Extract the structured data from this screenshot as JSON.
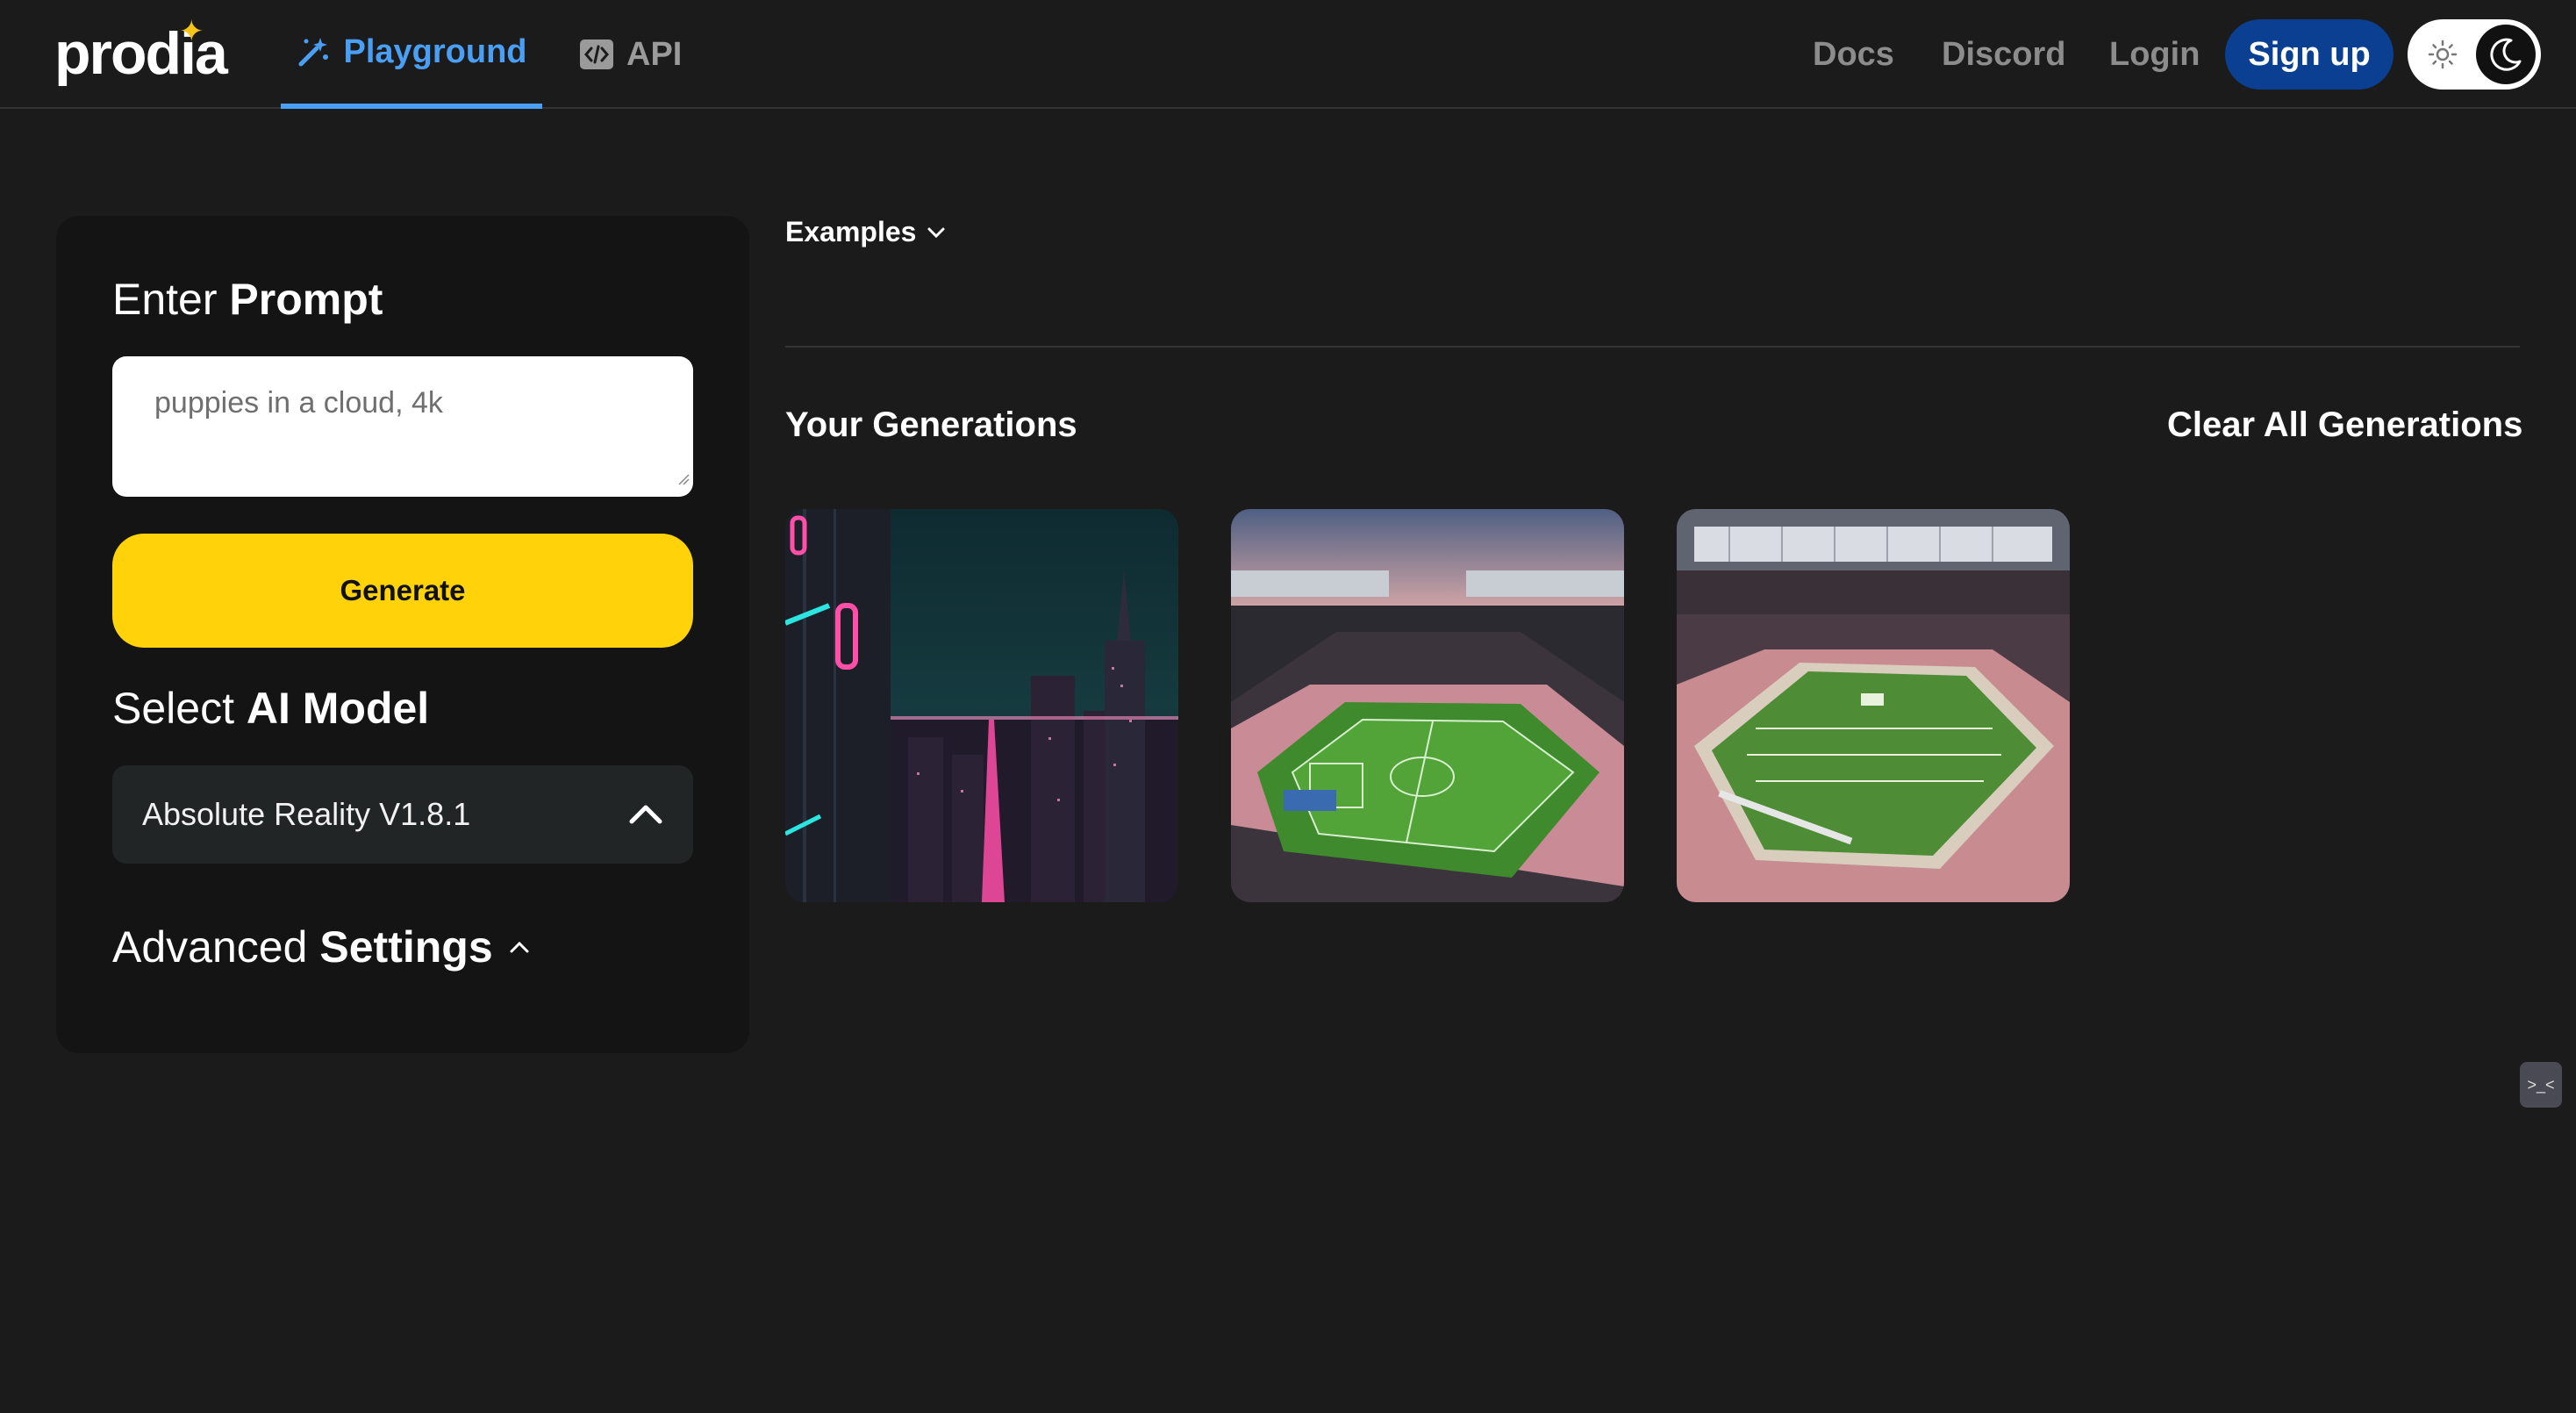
{
  "header": {
    "logo_text": "prodia",
    "tabs": [
      {
        "label": "Playground",
        "icon": "magic-wand-icon",
        "active": true
      },
      {
        "label": "API",
        "icon": "code-icon",
        "active": false
      }
    ],
    "links": [
      "Docs",
      "Discord",
      "Login"
    ],
    "signup_label": "Sign up",
    "theme": {
      "sun_icon": "sun-icon",
      "moon_icon": "moon-icon",
      "mode": "dark"
    }
  },
  "sidebar": {
    "prompt_heading": {
      "prefix": "Enter",
      "bold": "Prompt"
    },
    "prompt_placeholder": "puppies in a cloud, 4k",
    "generate_label": "Generate",
    "model_heading": {
      "prefix": "Select",
      "bold": "AI Model"
    },
    "selected_model": "Absolute Reality V1.8.1",
    "advanced_heading": {
      "prefix": "Advanced",
      "bold": "Settings"
    }
  },
  "main": {
    "examples_label": "Examples",
    "generations_title": "Your Generations",
    "clear_label": "Clear All Generations",
    "generations": [
      {
        "subject": "neon cyberpunk city at night"
      },
      {
        "subject": "soccer stadium at sunset"
      },
      {
        "subject": "american football stadium"
      }
    ]
  },
  "colors": {
    "background": "#1b1b1b",
    "accent": "#4a9ff5",
    "generate": "#ffd20a",
    "signup": "#0a3f91"
  }
}
